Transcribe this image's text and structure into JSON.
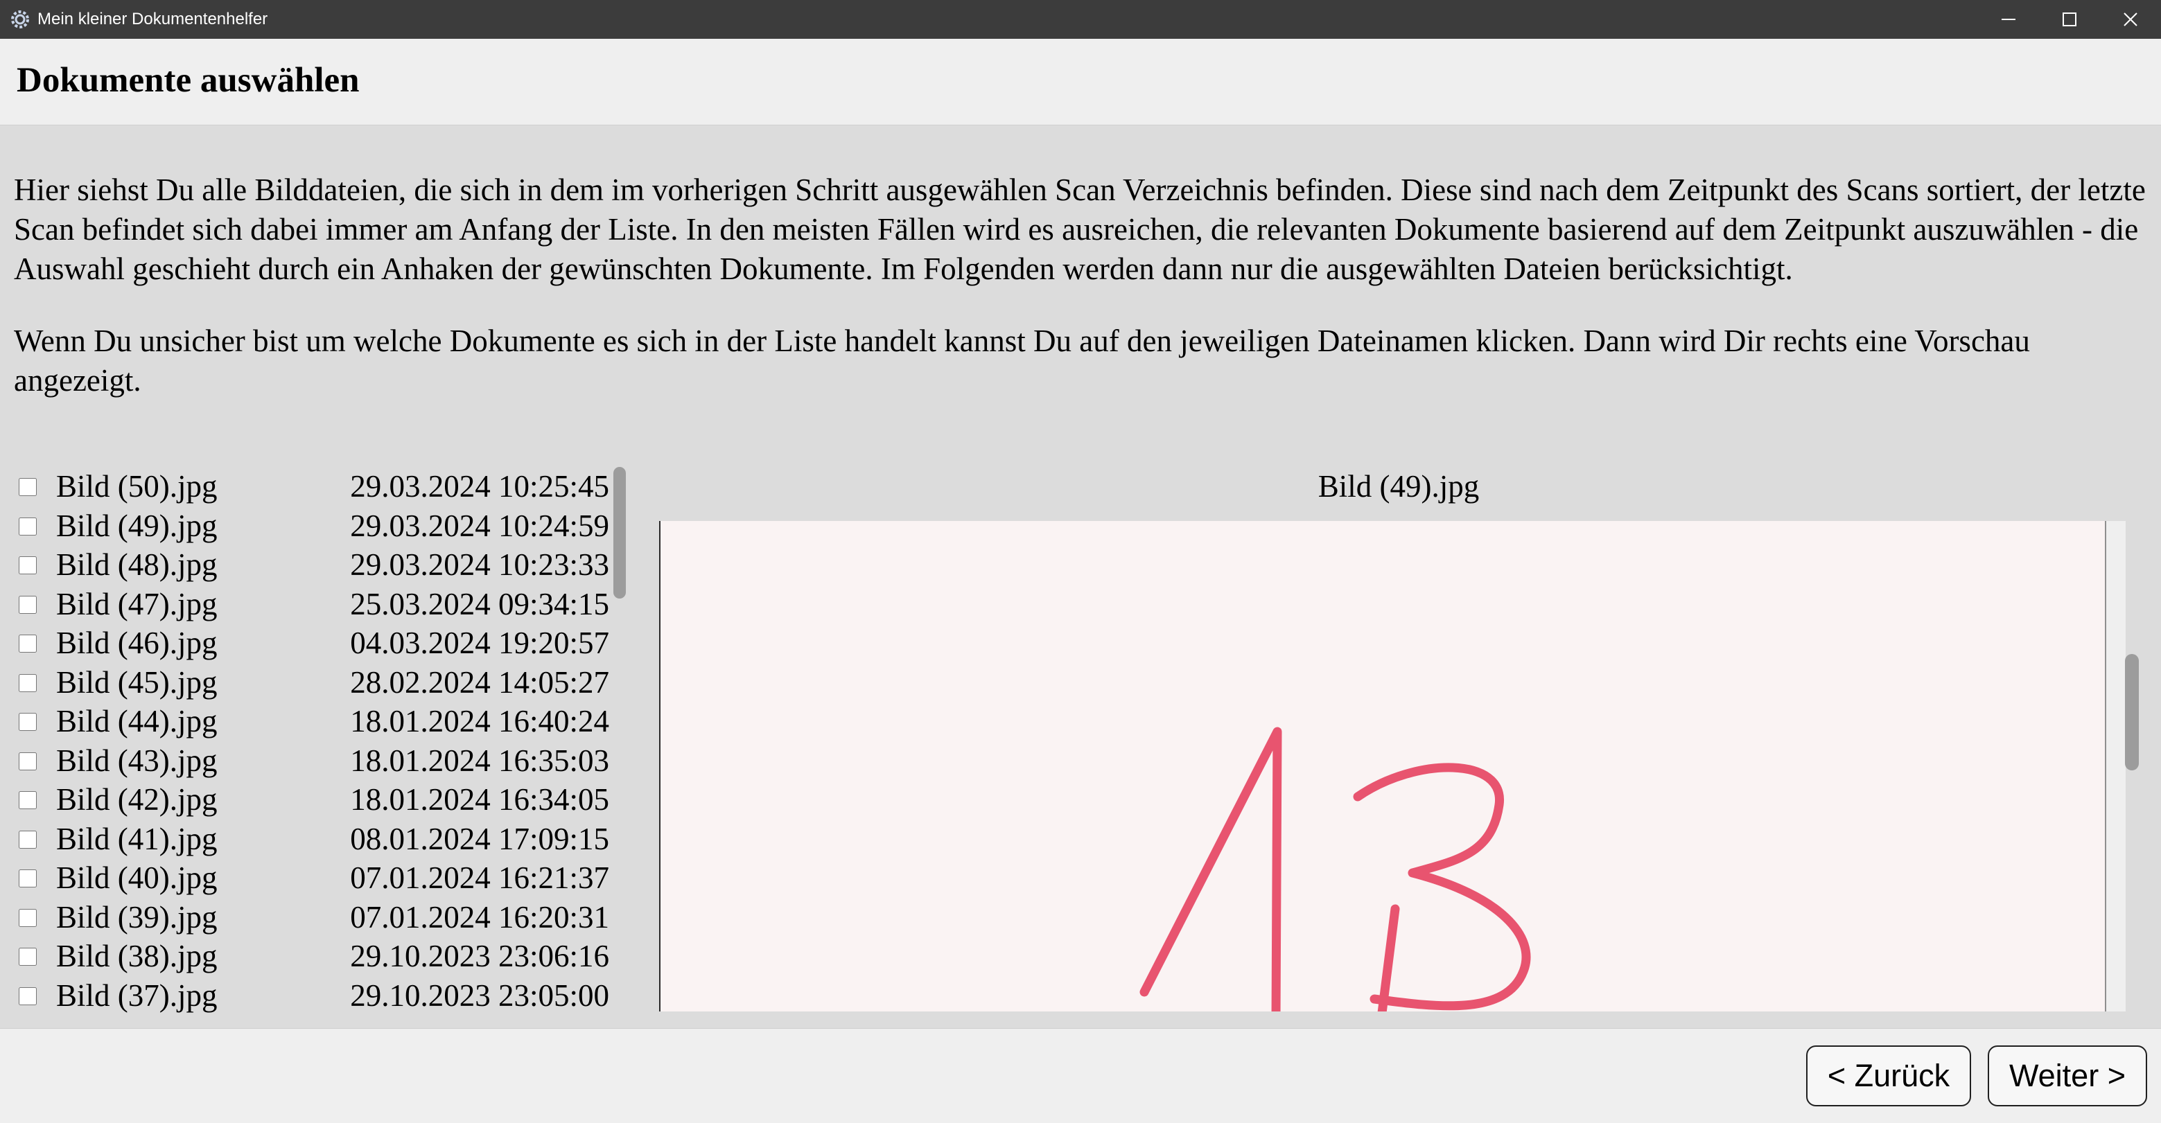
{
  "window": {
    "title": "Mein kleiner Dokumentenhelfer",
    "app_icon": "gear-icon",
    "controls": [
      "minimize-icon",
      "maximize-icon",
      "close-icon"
    ]
  },
  "header": {
    "title": "Dokumente auswählen"
  },
  "intro": {
    "paragraph_1": "Hier siehst Du alle Bilddateien, die sich in dem im vorherigen Schritt ausgewählen Scan Verzeichnis befinden. Diese sind nach dem Zeitpunkt des Scans sortiert, der letzte Scan befindet sich dabei immer am Anfang der Liste. In den meisten Fällen wird es ausreichen, die relevanten Dokumente basierend auf dem Zeitpunkt auszuwählen - die Auswahl geschieht durch ein Anhaken der gewünschten Dokumente. Im Folgenden werden dann nur die ausgewählten Dateien berücksichtigt.",
    "paragraph_2": "Wenn Du unsicher bist um welche Dokumente es sich in der Liste handelt kannst Du auf den jeweiligen Dateinamen klicken. Dann wird Dir rechts eine Vorschau angezeigt."
  },
  "files": [
    {
      "name": "Bild (50).jpg",
      "date": "29.03.2024 10:25:45",
      "checked": false
    },
    {
      "name": "Bild (49).jpg",
      "date": "29.03.2024 10:24:59",
      "checked": false
    },
    {
      "name": "Bild (48).jpg",
      "date": "29.03.2024 10:23:33",
      "checked": false
    },
    {
      "name": "Bild (47).jpg",
      "date": "25.03.2024 09:34:15",
      "checked": false
    },
    {
      "name": "Bild (46).jpg",
      "date": "04.03.2024 19:20:57",
      "checked": false
    },
    {
      "name": "Bild (45).jpg",
      "date": "28.02.2024 14:05:27",
      "checked": false
    },
    {
      "name": "Bild (44).jpg",
      "date": "18.01.2024 16:40:24",
      "checked": false
    },
    {
      "name": "Bild (43).jpg",
      "date": "18.01.2024 16:35:03",
      "checked": false
    },
    {
      "name": "Bild (42).jpg",
      "date": "18.01.2024 16:34:05",
      "checked": false
    },
    {
      "name": "Bild (41).jpg",
      "date": "08.01.2024 17:09:15",
      "checked": false
    },
    {
      "name": "Bild (40).jpg",
      "date": "07.01.2024 16:21:37",
      "checked": false
    },
    {
      "name": "Bild (39).jpg",
      "date": "07.01.2024 16:20:31",
      "checked": false
    },
    {
      "name": "Bild (38).jpg",
      "date": "29.10.2023 23:06:16",
      "checked": false
    },
    {
      "name": "Bild (37).jpg",
      "date": "29.10.2023 23:05:00",
      "checked": false
    }
  ],
  "preview": {
    "title": "Bild (49).jpg",
    "ink_color": "#e8546f",
    "paper_color": "#faf3f3"
  },
  "footer": {
    "back_label": "< Zurück",
    "next_label": "Weiter >"
  }
}
